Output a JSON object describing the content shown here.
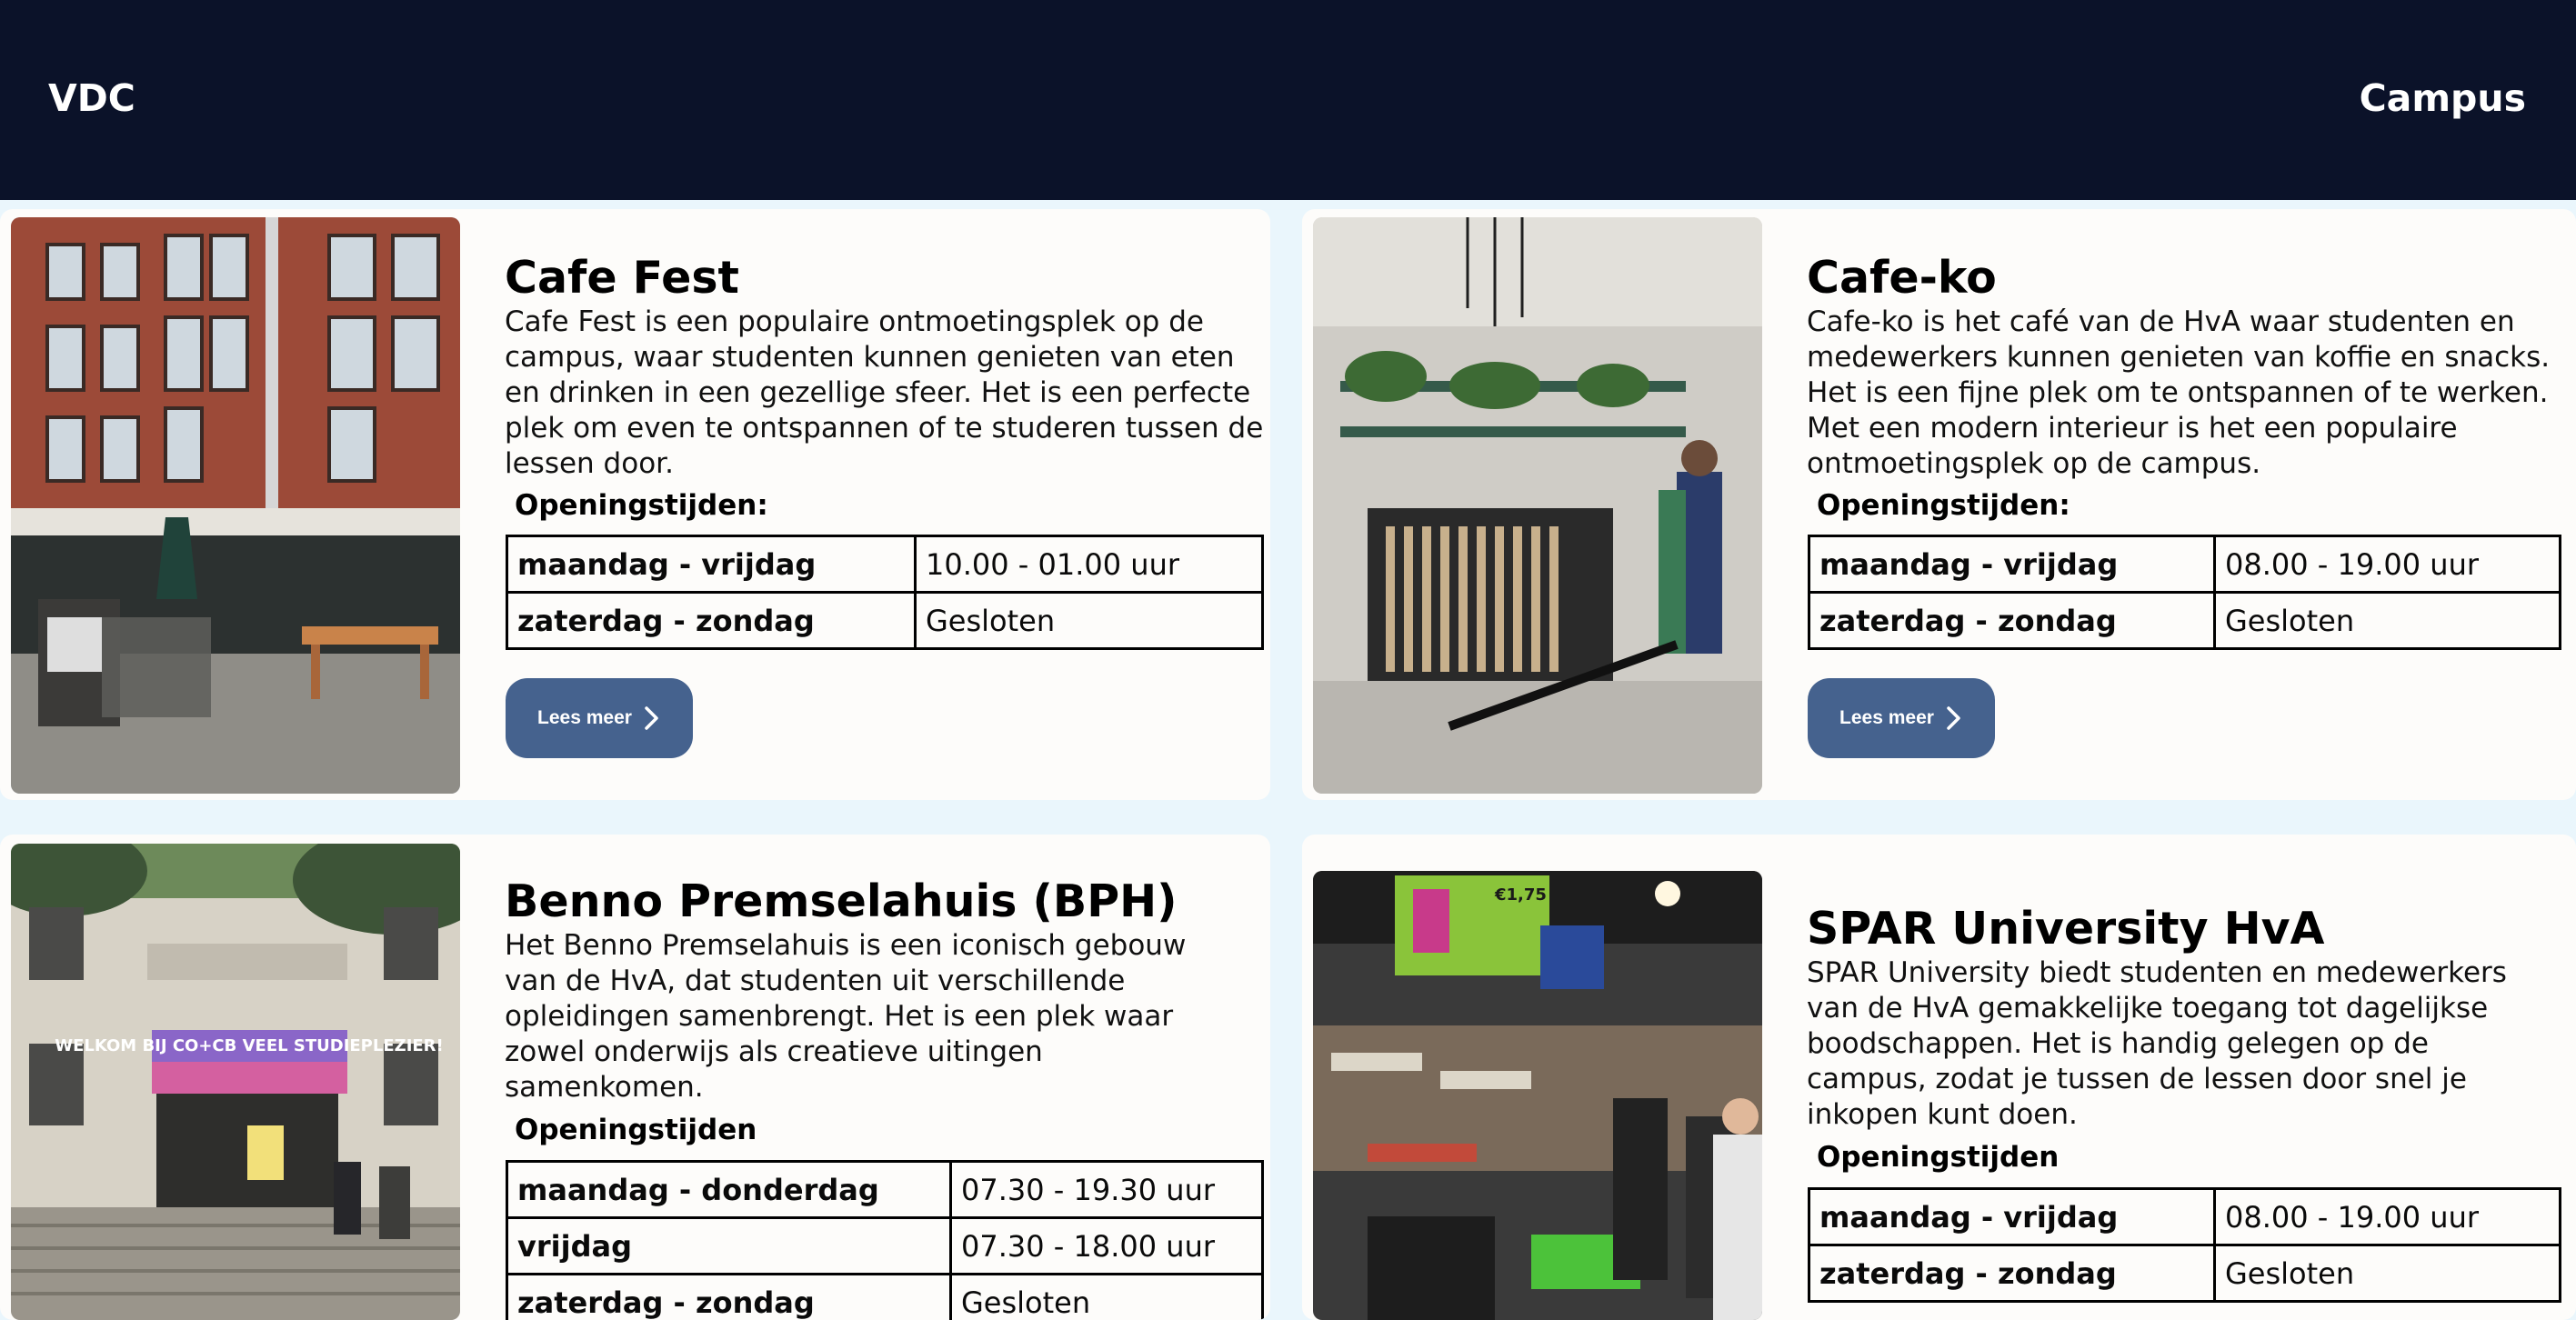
{
  "header": {
    "brand": "VDC",
    "nav_link": "Campus"
  },
  "cards": [
    {
      "title": "Cafe Fest",
      "description": "Cafe Fest is een populaire ontmoetingsplek op de campus, waar studenten kunnen genieten van eten en drinken in een gezellige sfeer. Het is een perfecte plek om even te ontspannen of te studeren tussen de lessen door.",
      "hours_label": "Openingstijden:",
      "hours": [
        {
          "day": "maandag - vrijdag",
          "time": "10.00 - 01.00 uur"
        },
        {
          "day": "zaterdag - zondag",
          "time": "Gesloten"
        }
      ],
      "button_label": "Lees meer",
      "image": "cafe-fest-building-photo"
    },
    {
      "title": "Cafe-ko",
      "description": "Cafe-ko is het café van de HvA waar studenten en medewerkers kunnen genieten van koffie en snacks. Het is een fijne plek om te ontspannen of te werken. Met een modern interieur is het een populaire ontmoetingsplek op de campus.",
      "hours_label": "Openingstijden:",
      "hours": [
        {
          "day": "maandag - vrijdag",
          "time": "08.00 - 19.00 uur"
        },
        {
          "day": "zaterdag - zondag",
          "time": "Gesloten"
        }
      ],
      "button_label": "Lees meer",
      "image": "cafe-ko-interior-photo"
    },
    {
      "title": "Benno Premselahuis (BPH)",
      "description": "Het Benno Premselahuis is een iconisch gebouw van de HvA, dat studenten uit verschillende opleidingen samenbrengt. Het is een plek waar zowel onderwijs als creatieve uitingen samenkomen.",
      "hours_label": "Openingstijden",
      "hours": [
        {
          "day": "maandag - donderdag",
          "time": "07.30 - 19.30 uur"
        },
        {
          "day": "vrijdag",
          "time": "07.30 - 18.00 uur"
        },
        {
          "day": "zaterdag - zondag",
          "time": "Gesloten"
        }
      ],
      "image": "benno-premselahuis-entrance-photo",
      "banner_text": "WELKOM BIJ CO+CB VEEL STUDIEPLEZIER!"
    },
    {
      "title": "SPAR University HvA",
      "description": "SPAR University biedt studenten en medewerkers van de HvA gemakkelijke toegang tot dagelijkse boodschappen. Het is handig gelegen op de campus, zodat je tussen de lessen door snel je inkopen kunt doen.",
      "hours_label": "Openingstijden",
      "hours": [
        {
          "day": "maandag - vrijdag",
          "time": "08.00 - 19.00 uur"
        },
        {
          "day": "zaterdag - zondag",
          "time": "Gesloten"
        }
      ],
      "image": "spar-university-store-photo",
      "screen_price": "€1,75"
    }
  ]
}
